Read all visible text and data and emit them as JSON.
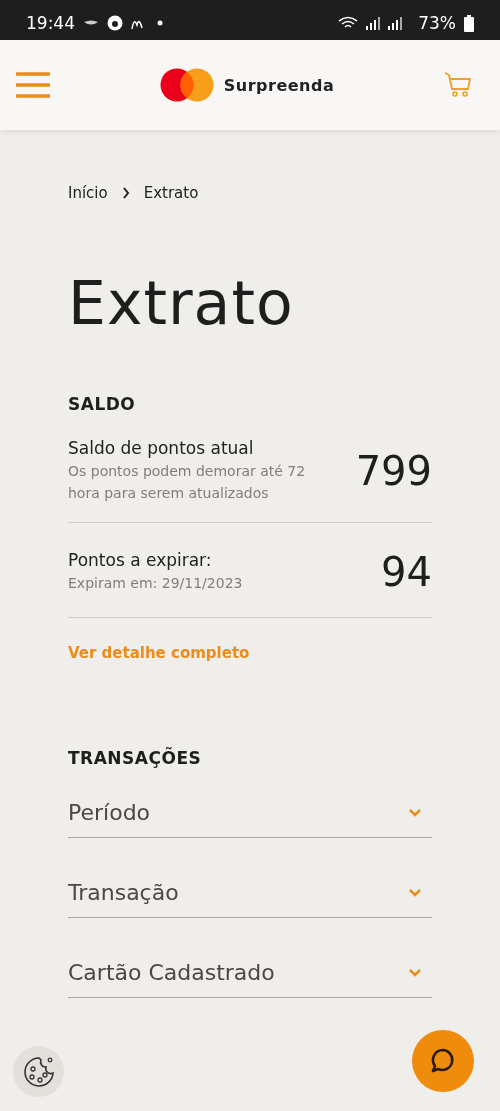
{
  "status_bar": {
    "time": "19:44",
    "battery": "73%"
  },
  "header": {
    "brand": "Surpreenda"
  },
  "breadcrumb": [
    {
      "label": "Início"
    },
    {
      "label": "Extrato"
    }
  ],
  "page_title": "Extrato",
  "balance": {
    "heading": "SALDO",
    "rows": [
      {
        "label": "Saldo de pontos atual",
        "note": "Os pontos podem demorar até 72 hora para serem atualizados",
        "value": "799"
      },
      {
        "label": "Pontos a expirar:",
        "note": "Expiram em: 29/11/2023",
        "value": "94"
      }
    ],
    "link": "Ver detalhe completo"
  },
  "transactions": {
    "heading": "TRANSAÇÕES",
    "filters": [
      {
        "label": "Período",
        "expanded": false
      },
      {
        "label": "Transação",
        "expanded": false
      },
      {
        "label": "Cartão Cadastrado",
        "expanded": false
      }
    ]
  }
}
